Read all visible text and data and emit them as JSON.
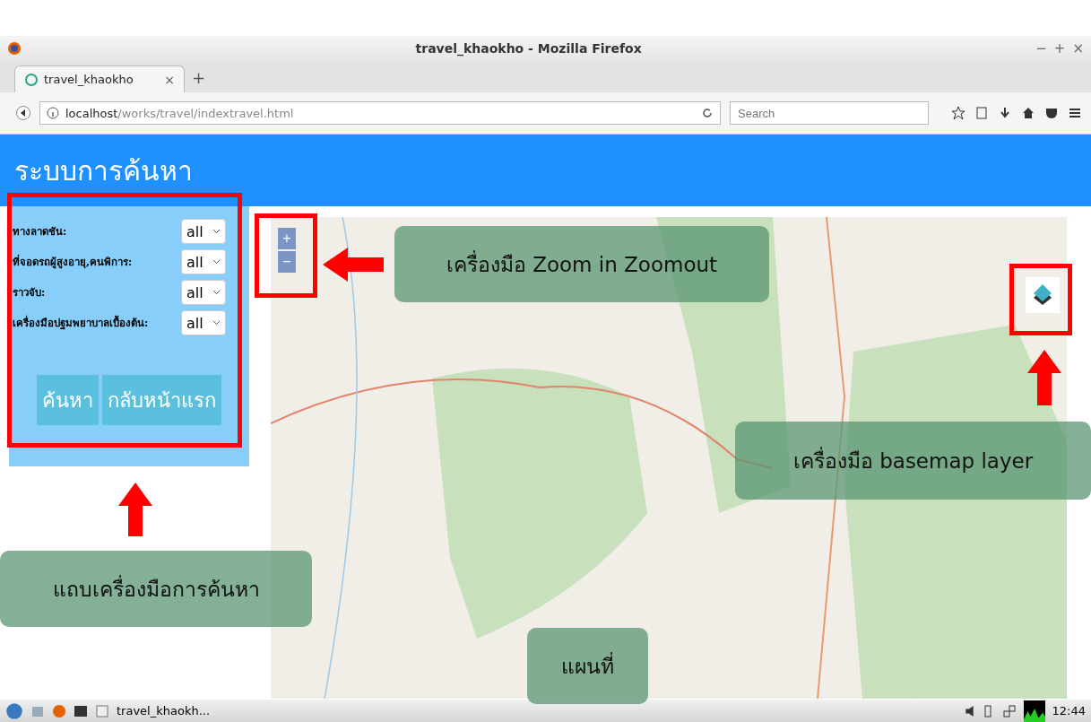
{
  "window": {
    "title": "travel_khaokho - Mozilla Firefox",
    "controls": [
      "−",
      "+",
      "×"
    ]
  },
  "tabs": [
    {
      "label": "travel_khaokho",
      "selected": true,
      "close": "×"
    }
  ],
  "new_tab": "+",
  "address": {
    "host": "localhost",
    "path": "/works/travel/indextravel.html"
  },
  "search": {
    "placeholder": "Search"
  },
  "page": {
    "title": "ระบบการค้นหา",
    "filters": [
      {
        "label": "ทางลาดชัน:",
        "value": "all"
      },
      {
        "label": "ที่จอดรถผู้สูงอายุ,คนพิการ:",
        "value": "all"
      },
      {
        "label": "ราวจับ:",
        "value": "all"
      },
      {
        "label": "เครื่องมือปฐมพยาบาลเบื้องต้น:",
        "value": "all"
      }
    ],
    "buttons": [
      "ค้นหา",
      "กลับหน้าแรก"
    ],
    "zoom": {
      "in": "+",
      "out": "−"
    }
  },
  "annotations": [
    {
      "kind": "zoom",
      "text": "เครื่องมือ Zoom in Zoomout"
    },
    {
      "kind": "basemap",
      "text": "เครื่องมือ basemap layer"
    },
    {
      "kind": "sidebar",
      "text": "แถบเครื่องมือการค้นหา"
    },
    {
      "kind": "map",
      "text": "แผนที่"
    }
  ],
  "taskbar": {
    "task": "travel_khaokh...",
    "clock": "12:44"
  }
}
